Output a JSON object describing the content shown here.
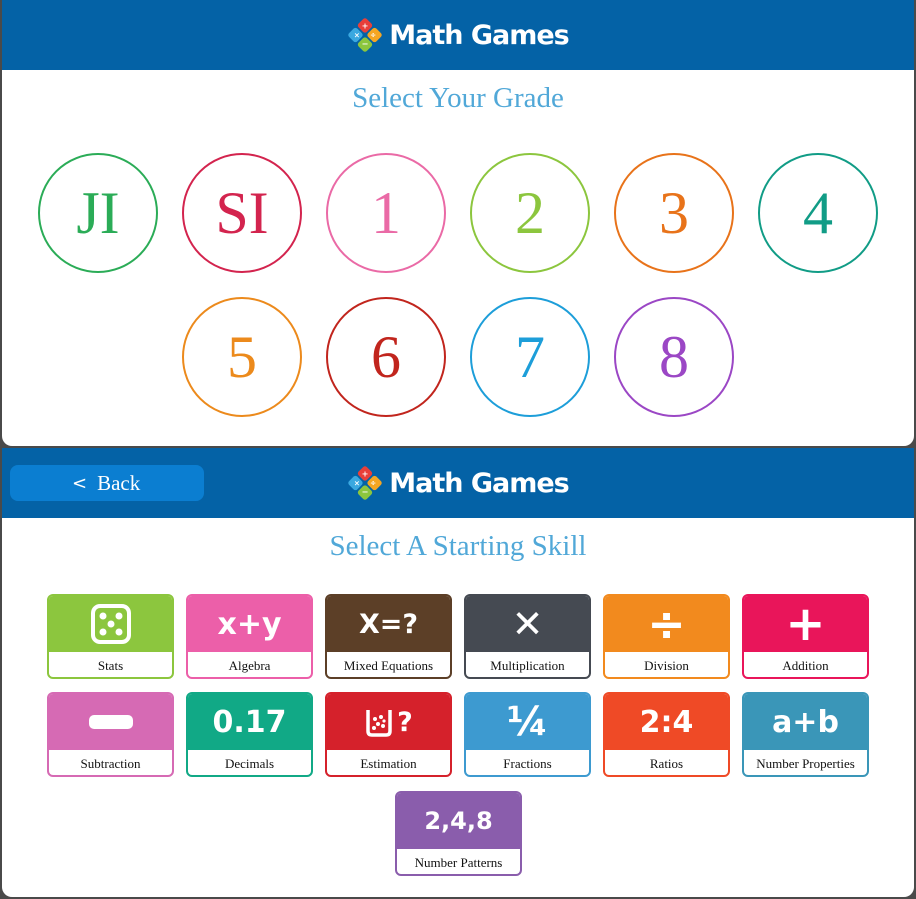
{
  "brand": {
    "name": "Math Games"
  },
  "grade_panel": {
    "title": "Select Your Grade",
    "grades": [
      {
        "label": "JI",
        "color": "#2bac57"
      },
      {
        "label": "SI",
        "color": "#d3244e"
      },
      {
        "label": "1",
        "color": "#ea6aa6"
      },
      {
        "label": "2",
        "color": "#8cc63e"
      },
      {
        "label": "3",
        "color": "#e8731a"
      },
      {
        "label": "4",
        "color": "#119c86"
      },
      {
        "label": "5",
        "color": "#ec8a1c"
      },
      {
        "label": "6",
        "color": "#c1251d"
      },
      {
        "label": "7",
        "color": "#1d9ed9"
      },
      {
        "label": "8",
        "color": "#9b47c5"
      }
    ]
  },
  "skill_panel": {
    "back_label": "Back",
    "title": "Select A Starting Skill",
    "skills": [
      {
        "label": "Stats",
        "icon": "dice-icon",
        "glyph": "",
        "color": "#8cc63e"
      },
      {
        "label": "Algebra",
        "icon": "xy-icon",
        "glyph": "x+y",
        "color": "#ec5fa9"
      },
      {
        "label": "Mixed Equations",
        "icon": "mixed-equation-icon",
        "glyph": "X=?",
        "color": "#5c3f27"
      },
      {
        "label": "Multiplication",
        "icon": "times-icon",
        "glyph": "✕",
        "color": "#454a52"
      },
      {
        "label": "Division",
        "icon": "divide-icon",
        "glyph": "÷",
        "color": "#f28a1e"
      },
      {
        "label": "Addition",
        "icon": "plus-icon",
        "glyph": "+",
        "color": "#e9155a"
      },
      {
        "label": "Subtraction",
        "icon": "minus-icon",
        "glyph": "",
        "color": "#d66ab4"
      },
      {
        "label": "Decimals",
        "icon": "decimal-icon",
        "glyph": "0.17",
        "color": "#11a986"
      },
      {
        "label": "Estimation",
        "icon": "jar-icon",
        "glyph": "?",
        "color": "#d5212b"
      },
      {
        "label": "Fractions",
        "icon": "quarter-icon",
        "glyph": "¼",
        "color": "#3d9ad0"
      },
      {
        "label": "Ratios",
        "icon": "ratio-icon",
        "glyph": "2:4",
        "color": "#ef4a26"
      },
      {
        "label": "Number Properties",
        "icon": "ab-icon",
        "glyph": "a+b",
        "color": "#3a96b8"
      },
      {
        "label": "Number Patterns",
        "icon": "pattern-icon",
        "glyph": "2,4,8",
        "color": "#8a5dac"
      }
    ]
  }
}
